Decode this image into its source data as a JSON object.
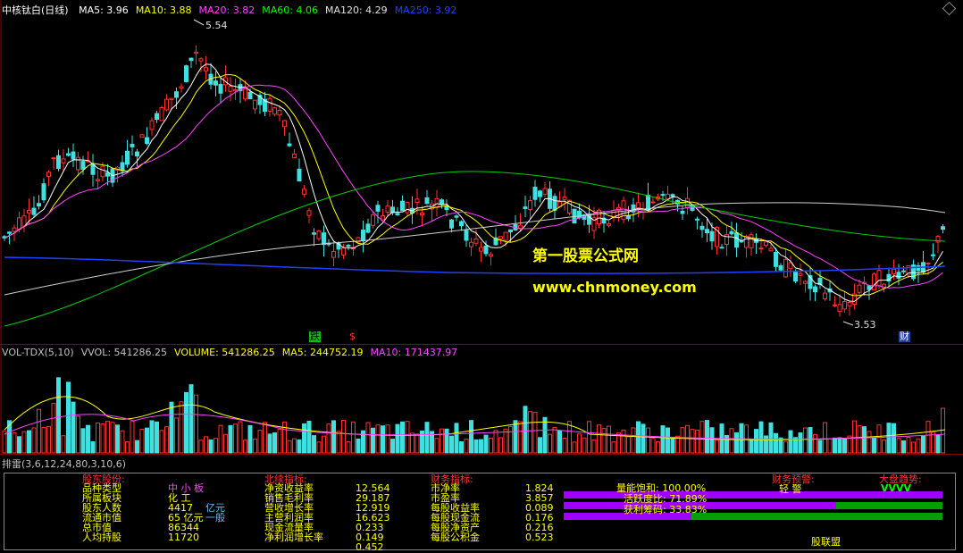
{
  "main": {
    "title": "中核钛白(日线)",
    "ma_labels": [
      {
        "text": "MA5: 3.96",
        "color": "#ffffff"
      },
      {
        "text": "MA10: 3.88",
        "color": "#ffff00"
      },
      {
        "text": "MA20: 3.82",
        "color": "#ff44ff"
      },
      {
        "text": "MA60: 4.06",
        "color": "#00ff00"
      },
      {
        "text": "MA120: 4.29",
        "color": "#e0e0e0"
      },
      {
        "text": "MA250: 3.92",
        "color": "#2040ff"
      }
    ],
    "high_label": "5.54",
    "low_label": "3.53",
    "watermark_title": "第一股票公式网",
    "watermark_url": "www.chnmoney.com",
    "marker_die": "跌",
    "marker_dollar": "$",
    "marker_cai": "财"
  },
  "volume": {
    "labels": [
      {
        "text": "VOL-TDX(5,10)",
        "color": "#c0c0c0"
      },
      {
        "text": "VVOL: 541286.25",
        "color": "#c0c0c0"
      },
      {
        "text": "VOLUME: 541286.25",
        "color": "#ffff00"
      },
      {
        "text": "MA5: 244752.19",
        "color": "#ffff00"
      },
      {
        "text": "MA10: 171437.97",
        "color": "#ff44ff"
      }
    ]
  },
  "bottom": {
    "title": "排雷(3,6,12,24,80,3,10,6)",
    "sections": {
      "gudong": "股东股份:",
      "beixu": "北续指标:",
      "caiwu": "财务指标:",
      "caiwu_warn": "财务预警:",
      "dapan": "大盘趋势:"
    },
    "col1_labels": [
      "品种类型",
      "所属板块",
      "股东人数",
      "流通市值",
      "总市值",
      "人均持股"
    ],
    "col1_values": [
      "中 小 板",
      "化 工",
      "4417",
      "65 亿元",
      "86344",
      "11720"
    ],
    "col1_extra": [
      "亿元",
      "一般"
    ],
    "col2_labels": [
      "净资收益率",
      "销售毛利率",
      "营收增长率",
      "主营利润率",
      "现金流量率",
      "净利润增长率"
    ],
    "col2_values": [
      "12.564",
      "29.187",
      "12.919",
      "16.623",
      "0.233",
      "0.149",
      "0.452"
    ],
    "col3_labels": [
      "市净率",
      "市盈率",
      "每股收益率",
      "每股现金流",
      "每股净资产",
      "每股公积金"
    ],
    "col3_values": [
      "1.824",
      "3.857",
      "0.089",
      "0.176",
      "0.216",
      "0.523"
    ],
    "bars": [
      {
        "label": "量能饱和: 100.00%",
        "pct": 100,
        "color": "#a000ff"
      },
      {
        "label": "活跃度比: 71.89%",
        "pct": 71.89,
        "color": "#a000ff"
      },
      {
        "label": "获利筹码: 33.83%",
        "pct": 33.83,
        "color": "#a000ff"
      }
    ],
    "warn_text": "轻 警",
    "trend_text": "VVVV",
    "footer": "股联盟"
  }
}
